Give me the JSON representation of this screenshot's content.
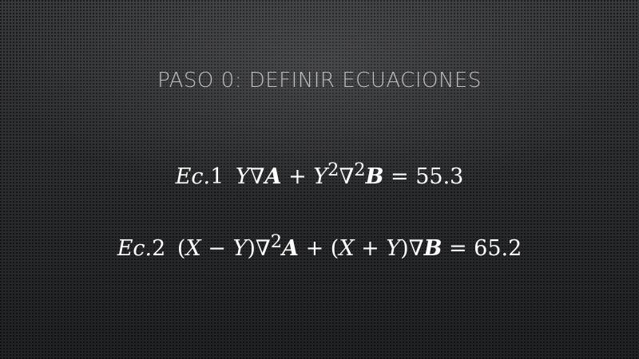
{
  "slide": {
    "title": "Paso 0: Definir ecuaciones",
    "equations": [
      {
        "label_prefix": "Ec.",
        "label_number": "1",
        "expression_html": "<i>Y</i>∇<b><i>A</i></b> + <i>Y</i><sup>2</sup>∇<sup>2</sup><b><i>B</i></b> = 55.3"
      },
      {
        "label_prefix": "Ec.",
        "label_number": "2",
        "expression_html": "(<i>X</i> − <i>Y</i>)∇<sup>2</sup><b><i>A</i></b> + (<i>X</i> + <i>Y</i>)∇<b><i>B</i></b> = 65.2"
      }
    ]
  }
}
